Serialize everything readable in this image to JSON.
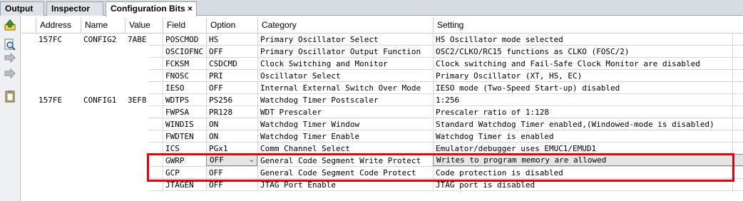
{
  "tabs": [
    {
      "label": "Output"
    },
    {
      "label": "Inspector"
    },
    {
      "label": "Configuration Bits",
      "close": "×"
    }
  ],
  "toolbar_icons": [
    "load-icon",
    "search-icon",
    "merge-icon",
    "split-icon",
    "clipboard-icon"
  ],
  "columns": [
    "Address",
    "Name",
    "Value",
    "Field",
    "Option",
    "Category",
    "Setting"
  ],
  "rows": [
    {
      "address": "157FC",
      "name": "CONFIG2",
      "value": "7ABE",
      "field": "POSCMOD",
      "option": "HS",
      "category": "Primary Oscillator Select",
      "setting": "HS Oscillator mode selected"
    },
    {
      "address": "",
      "name": "",
      "value": "",
      "field": "OSCIOFNC",
      "option": "OFF",
      "category": "Primary Oscillator Output Function",
      "setting": "OSC2/CLKO/RC15 functions as CLKO (FOSC/2)"
    },
    {
      "address": "",
      "name": "",
      "value": "",
      "field": "FCKSM",
      "option": "CSDCMD",
      "category": "Clock Switching and Monitor",
      "setting": "Clock switching and Fail-Safe Clock Monitor are disabled"
    },
    {
      "address": "",
      "name": "",
      "value": "",
      "field": "FNOSC",
      "option": "PRI",
      "category": "Oscillator Select",
      "setting": "Primary Oscillator (XT, HS, EC)"
    },
    {
      "address": "",
      "name": "",
      "value": "",
      "field": "IESO",
      "option": "OFF",
      "category": "Internal External Switch Over Mode",
      "setting": "IESO mode (Two-Speed Start-up) disabled"
    },
    {
      "address": "157FE",
      "name": "CONFIG1",
      "value": "3EF8",
      "field": "WDTPS",
      "option": "PS256",
      "category": "Watchdog Timer Postscaler",
      "setting": "1:256"
    },
    {
      "address": "",
      "name": "",
      "value": "",
      "field": "FWPSA",
      "option": "PR128",
      "category": "WDT Prescaler",
      "setting": "Prescaler ratio of 1:128"
    },
    {
      "address": "",
      "name": "",
      "value": "",
      "field": "WINDIS",
      "option": "ON",
      "category": "Watchdog Timer Window",
      "setting": "Standard Watchdog Timer enabled,(Windowed-mode is disabled)"
    },
    {
      "address": "",
      "name": "",
      "value": "",
      "field": "FWDTEN",
      "option": "ON",
      "category": "Watchdog Timer Enable",
      "setting": "Watchdog Timer is enabled"
    },
    {
      "address": "",
      "name": "",
      "value": "",
      "field": "ICS",
      "option": "PGx1",
      "category": "Comm Channel Select",
      "setting": "Emulator/debugger uses EMUC1/EMUD1"
    },
    {
      "address": "",
      "name": "",
      "value": "",
      "field": "GWRP",
      "option": "OFF",
      "category": "General Code Segment Write Protect",
      "setting": "Writes to program memory are allowed",
      "editing": true
    },
    {
      "address": "",
      "name": "",
      "value": "",
      "field": "GCP",
      "option": "OFF",
      "category": "General Code Segment Code Protect",
      "setting": "Code protection is disabled"
    },
    {
      "address": "",
      "name": "",
      "value": "",
      "field": "JTAGEN",
      "option": "OFF",
      "category": "JTAG Port Enable",
      "setting": "JTAG port is disabled"
    }
  ],
  "colors": {
    "highlight_box": "#e8000b",
    "grid_line": "#d5d8dc",
    "tab_bar": "#d7dce3"
  }
}
